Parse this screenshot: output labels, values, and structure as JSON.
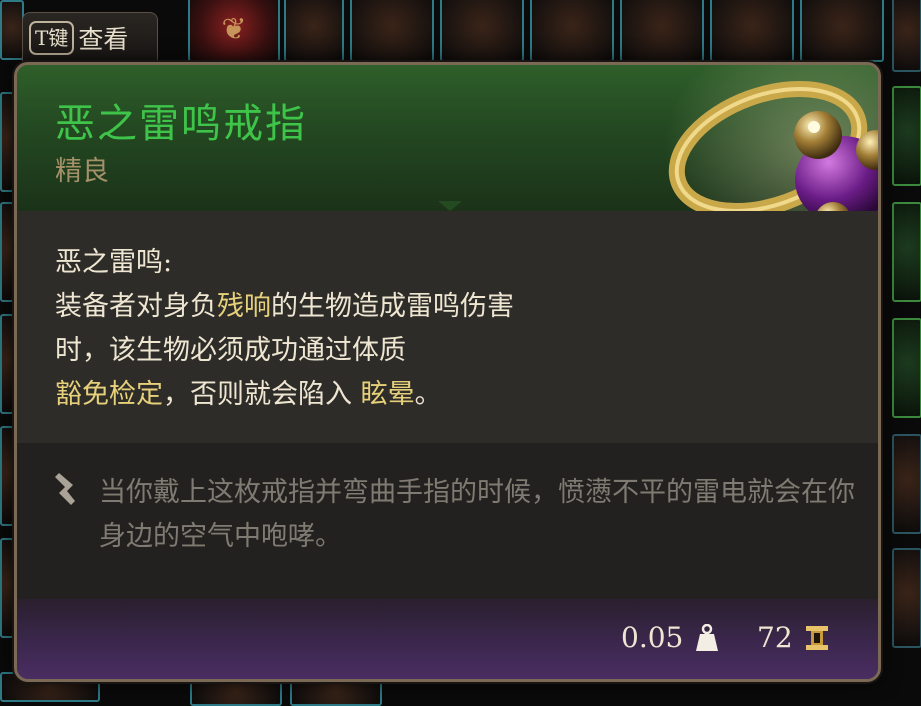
{
  "key_hint": {
    "key": "T键",
    "label": "查看"
  },
  "item": {
    "name": "恶之雷鸣戒指",
    "rarity": "精良",
    "name_color": "#3fc44a",
    "rarity_color": "#a4916a"
  },
  "effect": {
    "title": "恶之雷鸣:",
    "line1_a": "装备者对身负",
    "line1_hl": "残响",
    "line1_b": "的生物造成雷鸣伤害",
    "line2": "时，该生物必须成功通过体质",
    "line3_hl": "豁免检定",
    "line3_b": "，否则就会陷入 ",
    "line3_hl2": "眩晕",
    "line3_c": "。",
    "highlight_color": "#e6d07a"
  },
  "flavor": {
    "text": "当你戴上这枚戒指并弯曲手指的时候，愤懑不平的雷电就会在你身边的空气中咆哮。"
  },
  "stats": {
    "weight": "0.05",
    "weight_icon": "weight-icon",
    "value": "72",
    "value_icon": "gold-icon"
  }
}
